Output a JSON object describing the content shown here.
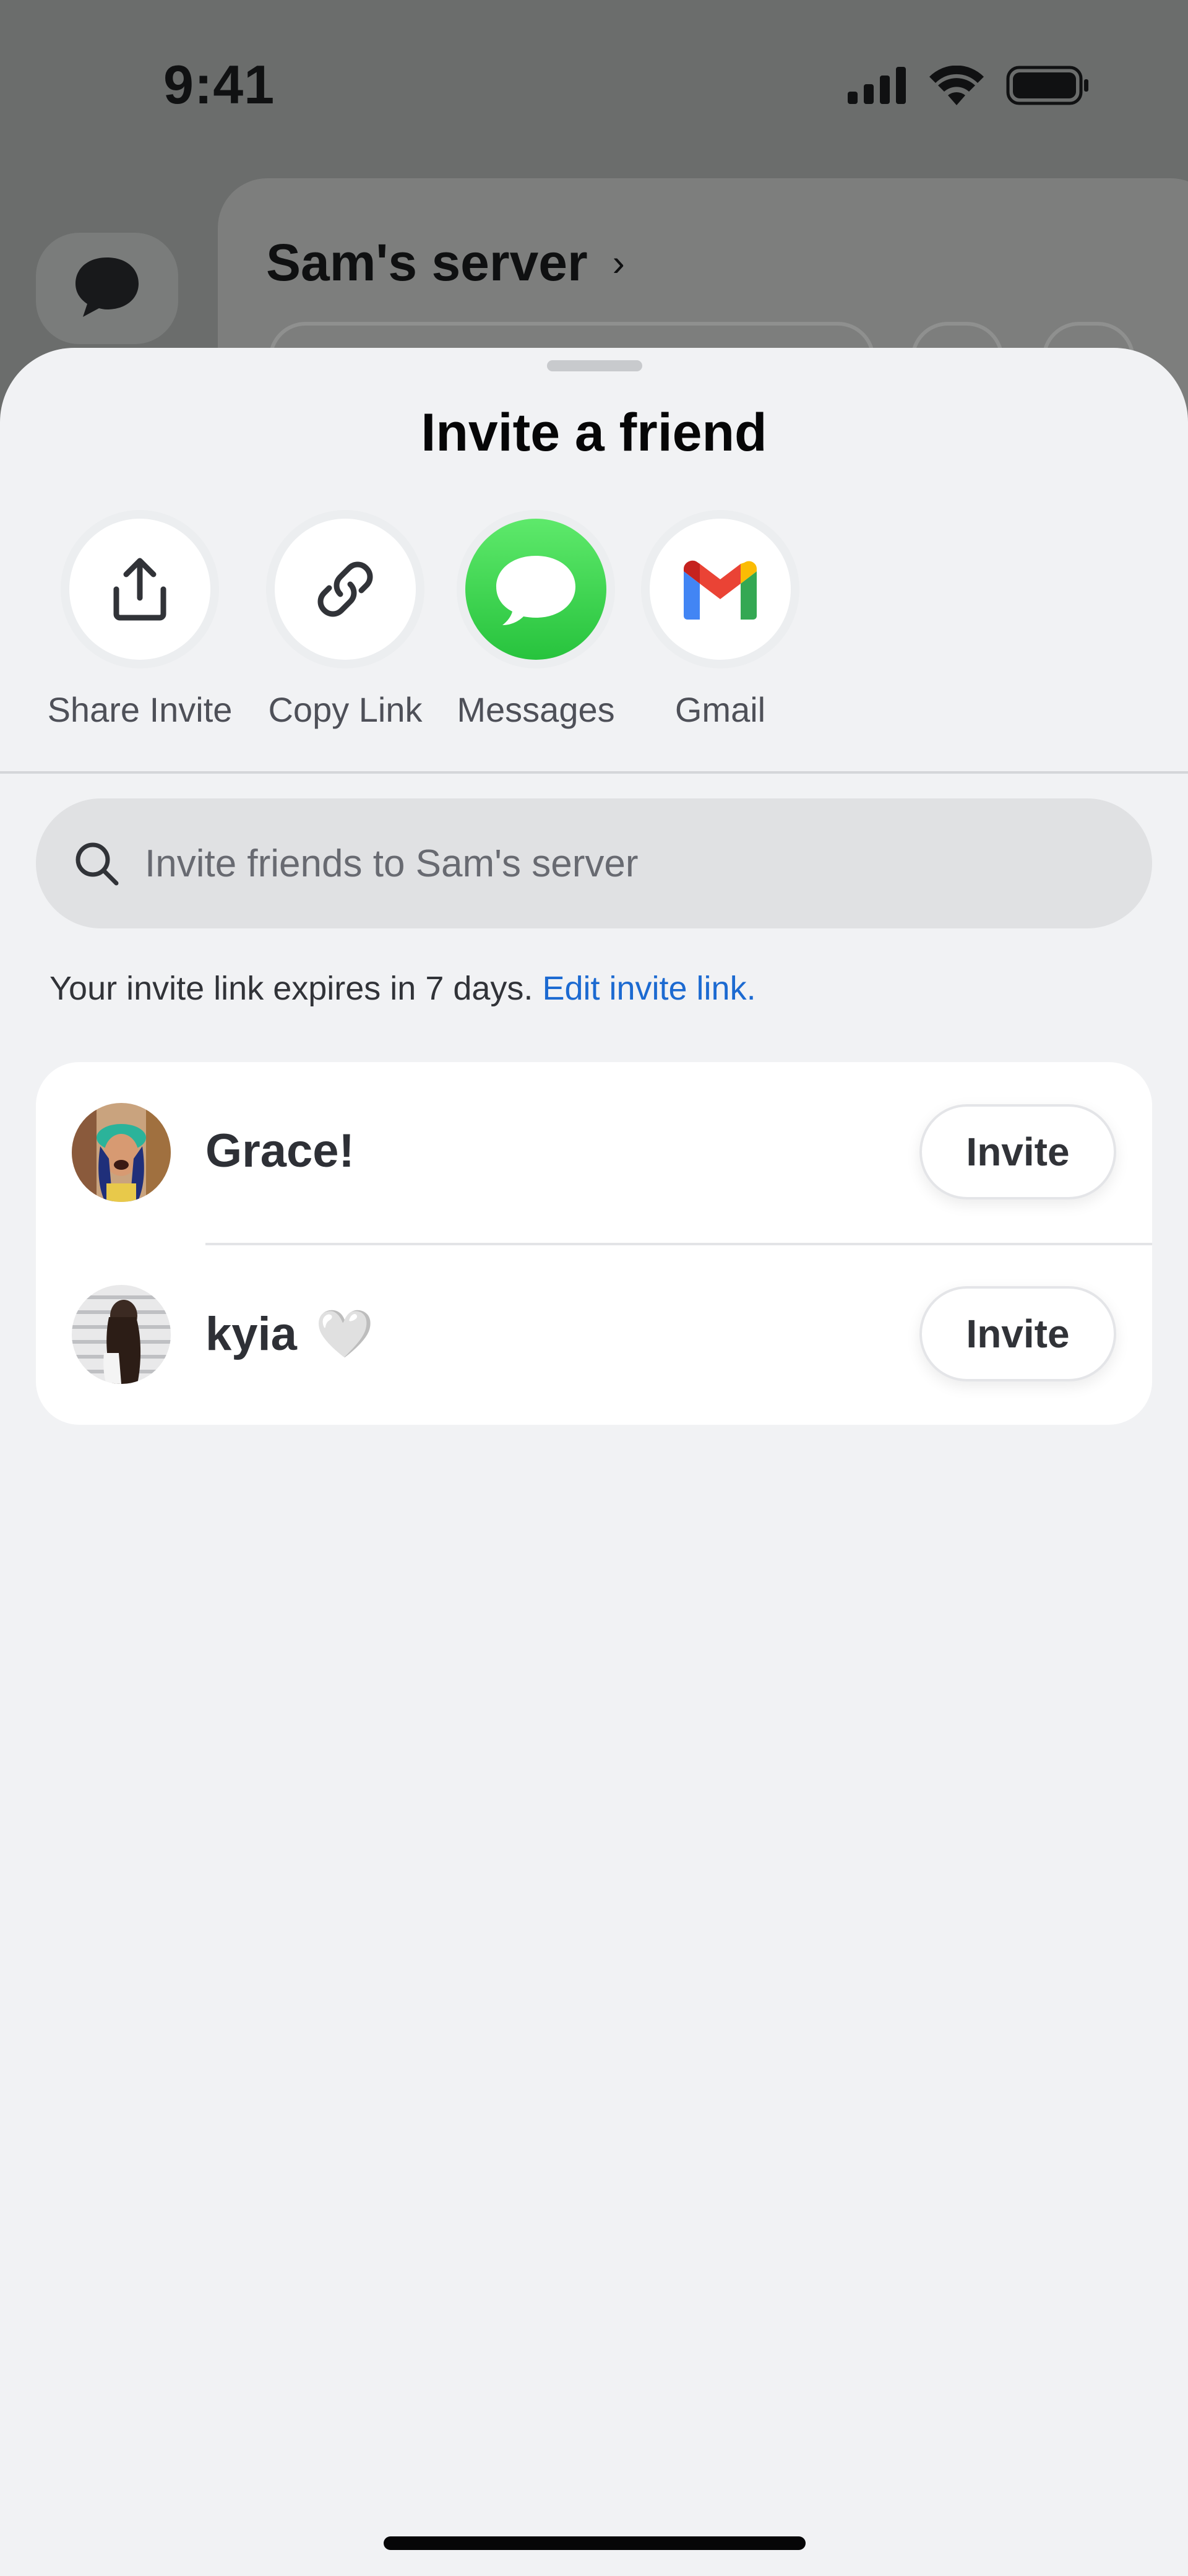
{
  "status_bar": {
    "time": "9:41"
  },
  "background": {
    "server_name": "Sam's server",
    "chevron": "›"
  },
  "sheet": {
    "title": "Invite a friend",
    "share_options": [
      {
        "label": "Share Invite",
        "icon": "share-icon"
      },
      {
        "label": "Copy Link",
        "icon": "link-icon"
      },
      {
        "label": "Messages",
        "icon": "messages-icon"
      },
      {
        "label": "Gmail",
        "icon": "gmail-icon"
      }
    ],
    "search": {
      "placeholder": "Invite friends to Sam's server"
    },
    "expiry": {
      "text": "Your invite link expires in 7 days.",
      "link": "Edit invite link."
    },
    "friends": [
      {
        "name": "Grace!",
        "button": "Invite"
      },
      {
        "name": "kyia",
        "emoji": "🤍",
        "button": "Invite"
      }
    ]
  },
  "colors": {
    "link": "#1c6ad1",
    "messages_green": "#34c759",
    "sheet_bg": "#f1f2f4"
  }
}
